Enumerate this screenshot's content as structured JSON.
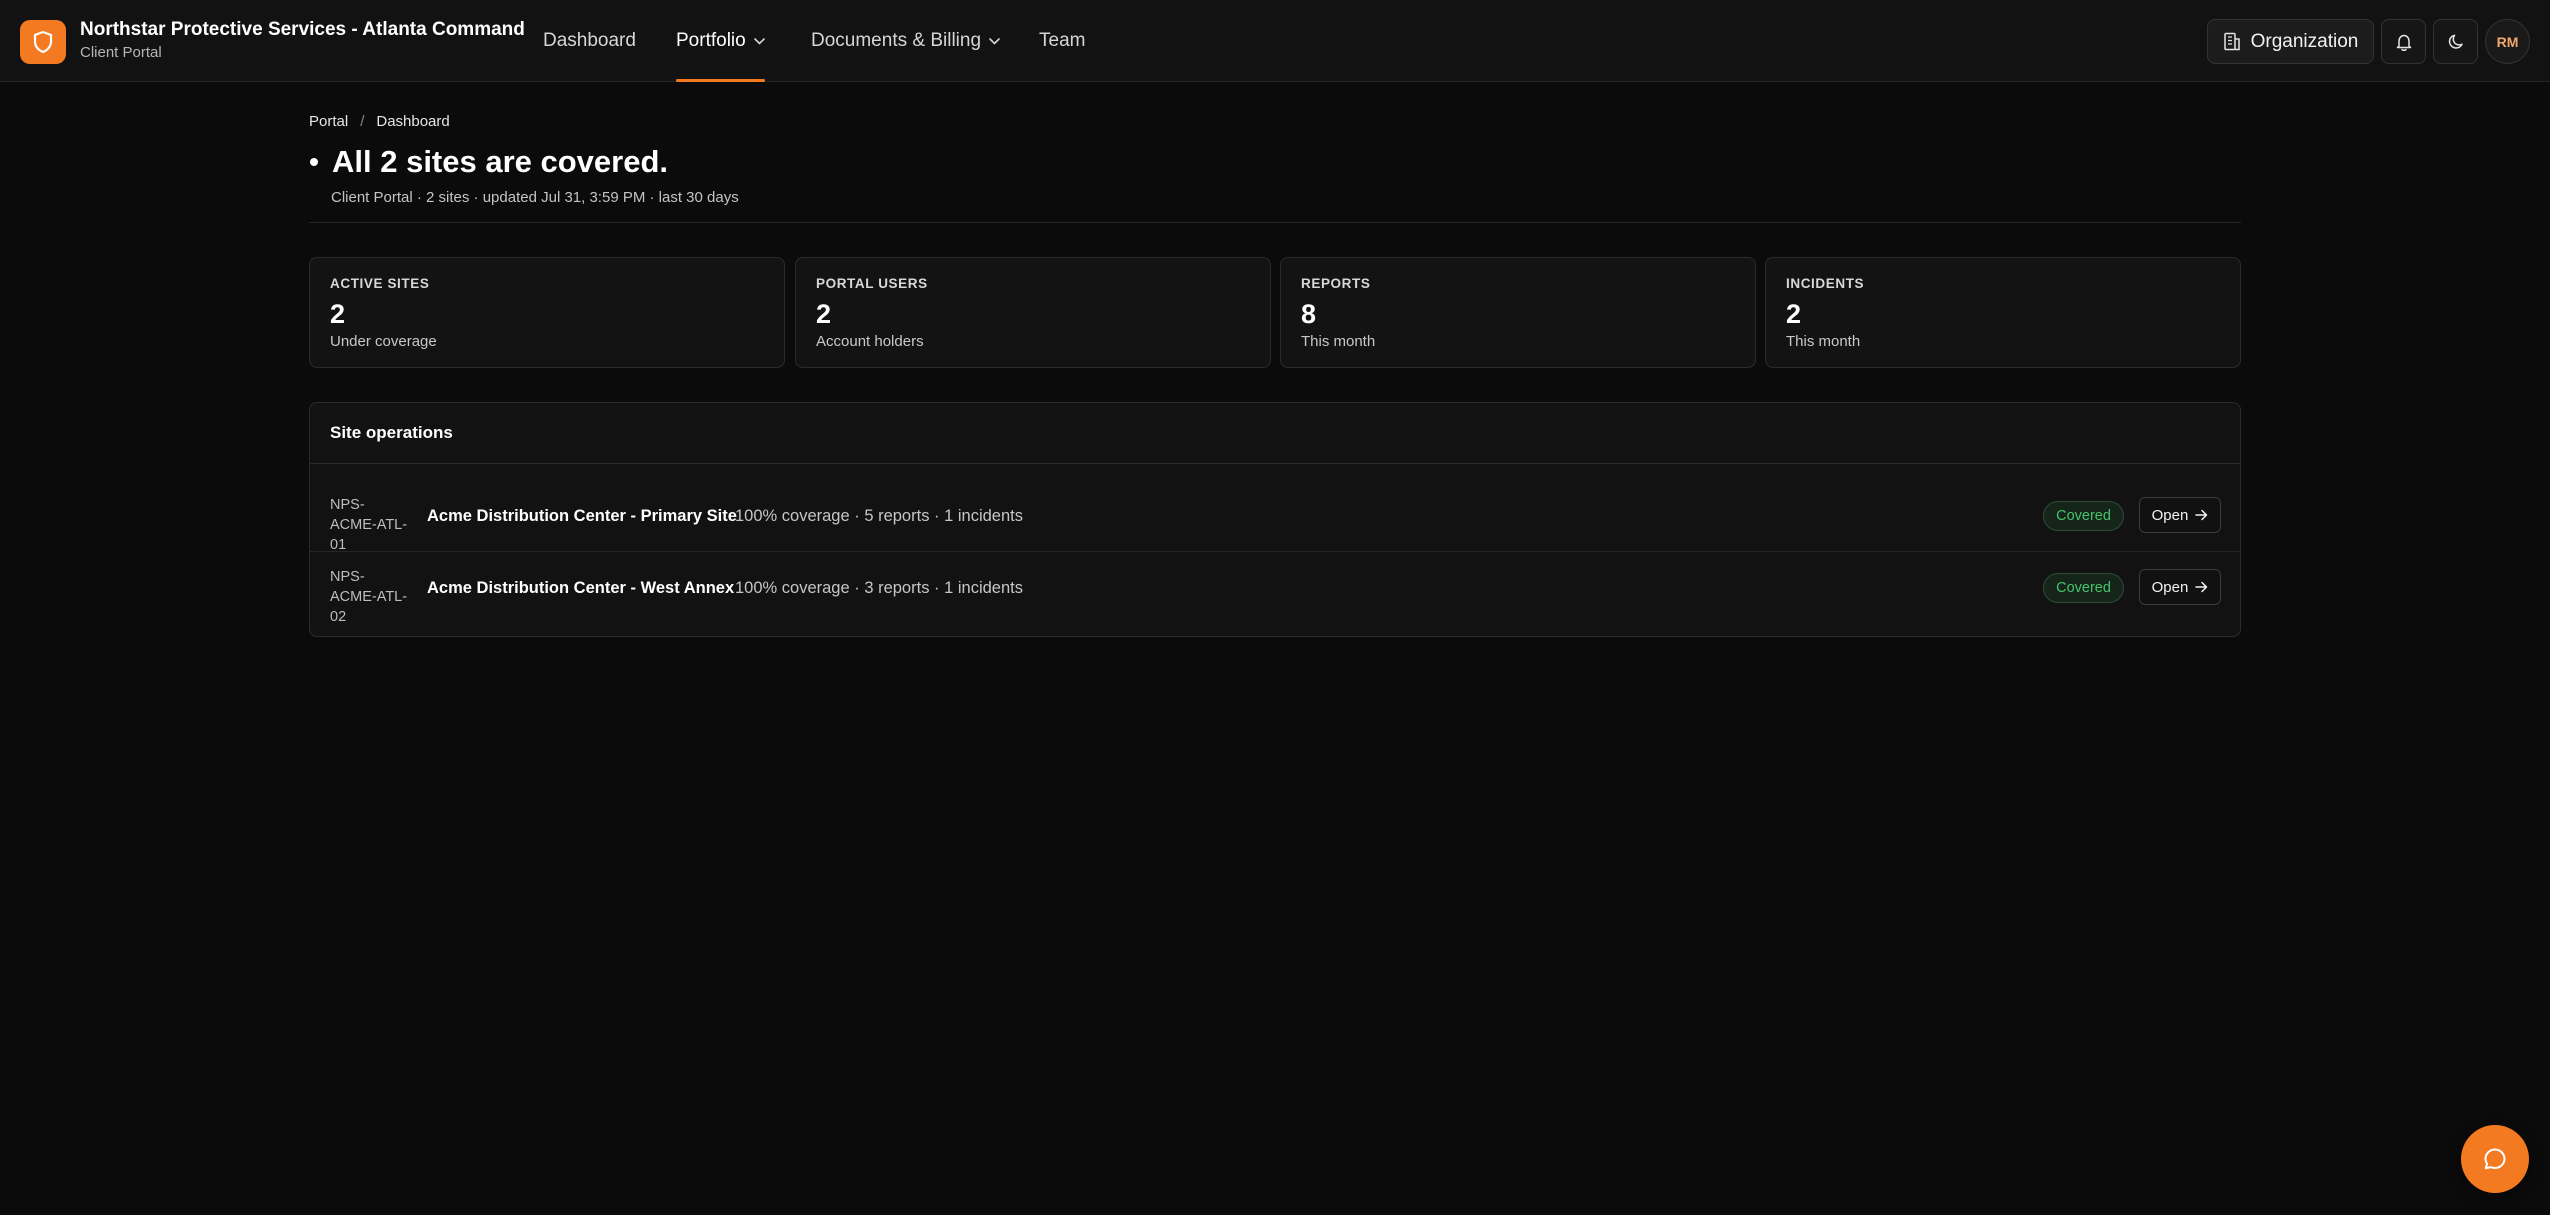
{
  "app": {
    "title": "Northstar Protective Services - Atlanta Command",
    "subtitle": "Client Portal",
    "brand_color": "#f47a22",
    "logo_icon": "shield-icon"
  },
  "nav": {
    "items": [
      {
        "label": "Dashboard",
        "active": false,
        "has_dropdown": false
      },
      {
        "label": "Portfolio",
        "active": true,
        "has_dropdown": true
      },
      {
        "label": "Documents & Billing",
        "active": false,
        "has_dropdown": true
      },
      {
        "label": "Team",
        "active": false,
        "has_dropdown": false
      }
    ]
  },
  "toolbar": {
    "organization_label": "Organization",
    "organization_icon": "building-icon",
    "notifications_icon": "bell-icon",
    "theme_icon": "moon-icon",
    "avatar_initials": "RM"
  },
  "breadcrumb": {
    "items": [
      "Portal",
      "Dashboard"
    ],
    "separator": "/"
  },
  "header": {
    "title": "All 2 sites are covered.",
    "subtitle": "Client Portal · 2 sites · updated Jul 31, 3:59 PM · last 30 days"
  },
  "stats": [
    {
      "label": "ACTIVE SITES",
      "value": "2",
      "sub": "Under coverage"
    },
    {
      "label": "PORTAL USERS",
      "value": "2",
      "sub": "Account holders"
    },
    {
      "label": "REPORTS",
      "value": "8",
      "sub": "This month"
    },
    {
      "label": "INCIDENTS",
      "value": "2",
      "sub": "This month"
    }
  ],
  "sites": {
    "title": "Site operations",
    "rows": [
      {
        "code_lines": [
          "NPS-",
          "ACME-ATL-",
          "01"
        ],
        "name": "Acme Distribution Center - Primary Site",
        "meta": "100% coverage · 5 reports · 1 incidents",
        "status": "Covered",
        "action": "Open"
      },
      {
        "code_lines": [
          "NPS-",
          "ACME-ATL-",
          "02"
        ],
        "name": "Acme Distribution Center - West Annex",
        "meta": "100% coverage · 3 reports · 1 incidents",
        "status": "Covered",
        "action": "Open"
      }
    ],
    "status_color": "#47c46b"
  },
  "chat": {
    "icon": "chat-bubble-icon"
  }
}
